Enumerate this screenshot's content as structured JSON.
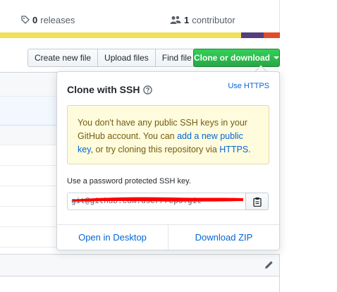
{
  "summary": {
    "releases_count": "0",
    "releases_label": "releases",
    "contributors_count": "1",
    "contributors_label": "contributor"
  },
  "language_bar": {
    "colors": [
      "#f1e05a",
      "#563d7c",
      "#e34c26"
    ]
  },
  "file_nav": {
    "create_new_file": "Create new file",
    "upload_files": "Upload files",
    "find_file": "Find file",
    "clone_or_download": "Clone or download"
  },
  "clone_dropdown": {
    "title": "Clone with SSH",
    "use_https": "Use HTTPS",
    "flash": {
      "text_before": "You don't have any public SSH keys in your GitHub account. You can ",
      "link_add_key": "add a new public key",
      "text_middle": ", or try cloning this repository via ",
      "link_https": "HTTPS",
      "text_after": "."
    },
    "hint": "Use a password protected SSH key.",
    "url_value": "git@github.com:user/repo.git",
    "open_in_desktop": "Open in Desktop",
    "download_zip": "Download ZIP"
  },
  "colors": {
    "primary_green": "#28a745",
    "link_blue": "#0366d6",
    "flash_background": "#fffbdd",
    "redaction_red": "#ff0000"
  },
  "icons": [
    "tag-icon",
    "people-icon",
    "question-icon",
    "clipboard-icon",
    "pencil-icon",
    "caret-down-icon"
  ]
}
